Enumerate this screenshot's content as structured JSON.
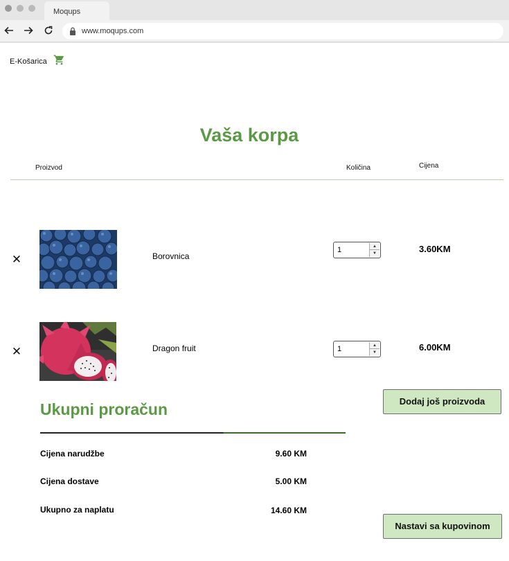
{
  "browser": {
    "tab_title": "Moqups",
    "url": "www.moqups.com"
  },
  "header": {
    "brand": "E-Košarica",
    "cart_icon": "shopping-cart-icon",
    "accent_color": "#5b9a44"
  },
  "cart": {
    "title": "Vaša korpa",
    "columns": {
      "product": "Proizvod",
      "quantity": "Količina",
      "price": "Cijena"
    },
    "items": [
      {
        "name": "Borovnica",
        "quantity": "1",
        "price": "3.60KM",
        "image": "blueberries-photo"
      },
      {
        "name": "Dragon fruit",
        "quantity": "1",
        "price": "6.00KM",
        "image": "dragon-fruit-photo"
      }
    ],
    "add_more_label": "Dodaj još proizvoda"
  },
  "summary": {
    "title": "Ukupni proračun",
    "rows": [
      {
        "label": "Cijena narudžbe",
        "value": "9.60 KM"
      },
      {
        "label": "Cijena dostave",
        "value": "5.00 KM"
      },
      {
        "label": "Ukupno za naplatu",
        "value": "14.60 KM"
      }
    ],
    "continue_label": "Nastavi sa kupovinom"
  }
}
